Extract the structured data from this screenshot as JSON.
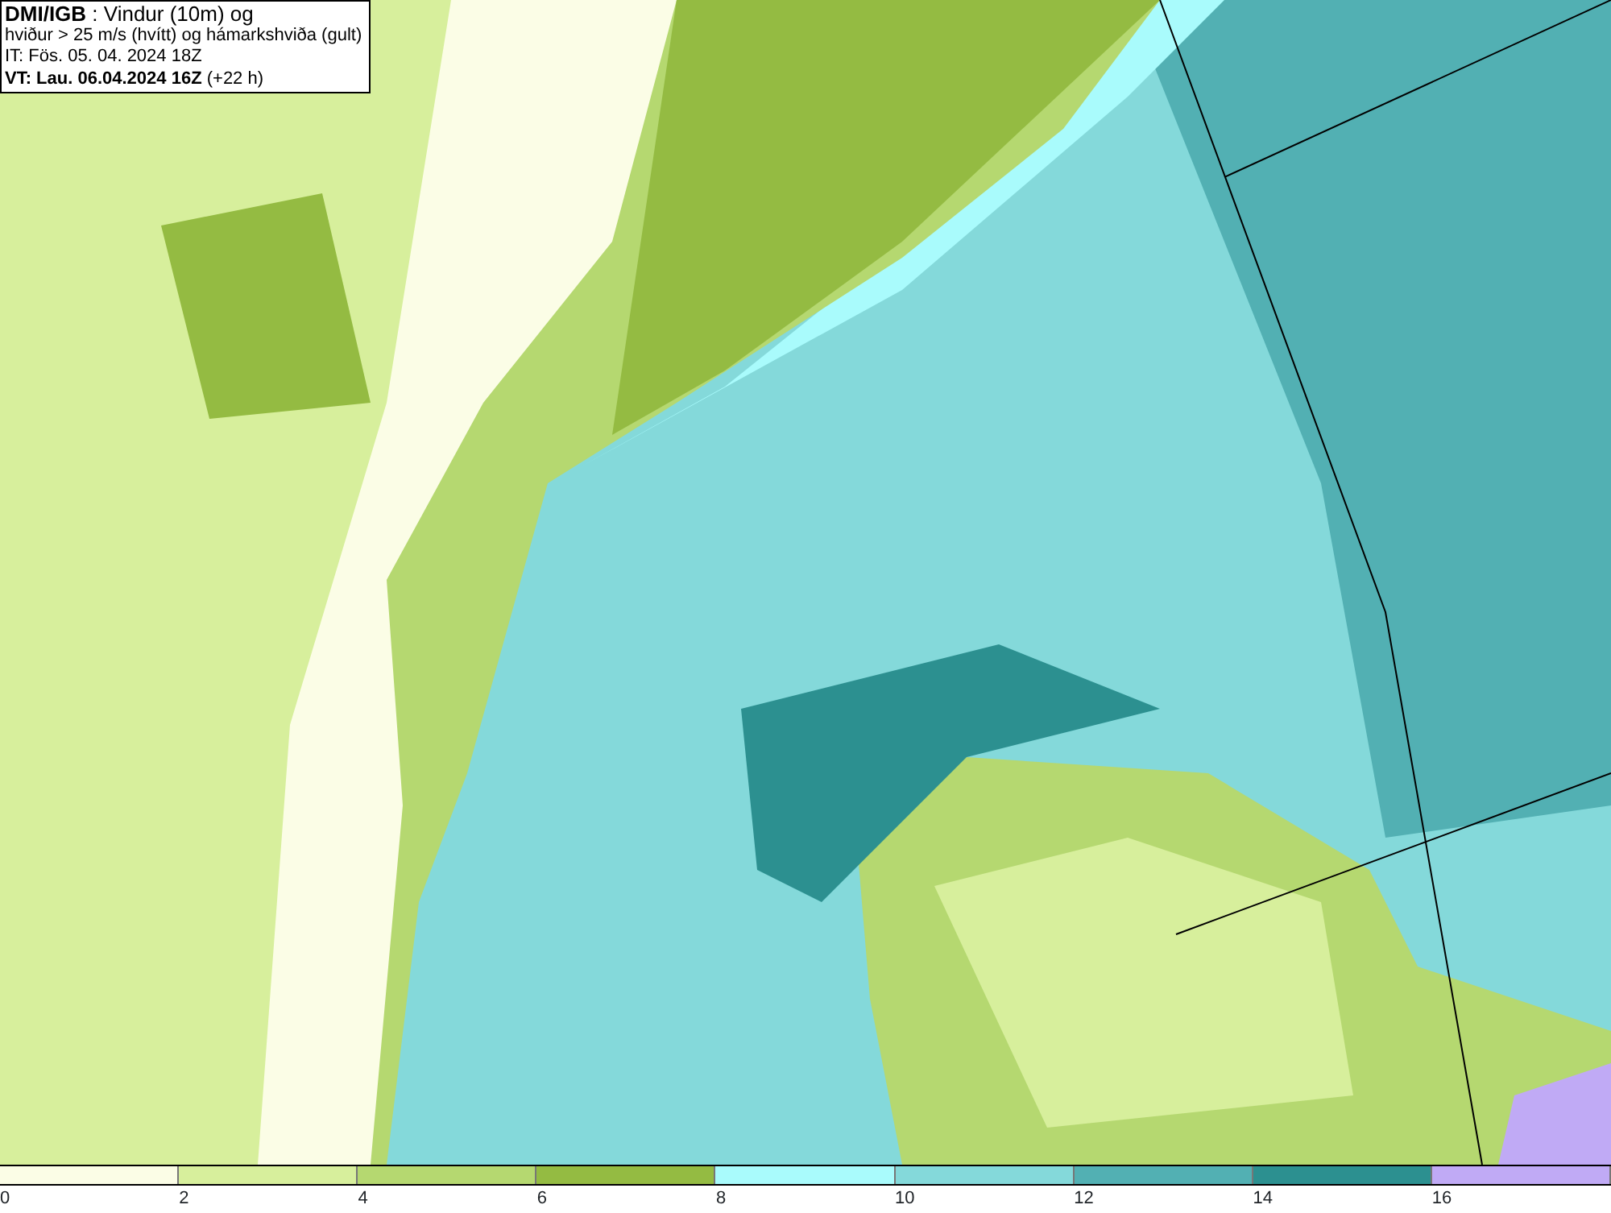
{
  "header": {
    "lines": [
      "**DMI/IGB** : Vindur (10m) og",
      "hviður > 25 m/s (hvítt) og hámarkshviða (gult)",
      "IT: Fös. 05. 04. 2024 18Z",
      "**VT: Lau. 06.04.2024 16Z** (+22 h)"
    ]
  },
  "legend": [
    {
      "label": "0",
      "color": "#fbfde6"
    },
    {
      "label": "2",
      "color": "#d7ef9c"
    },
    {
      "label": "4",
      "color": "#b5d870"
    },
    {
      "label": "6",
      "color": "#94bb42"
    },
    {
      "label": "8",
      "color": "#a9fbfc"
    },
    {
      "label": "10",
      "color": "#84d9da"
    },
    {
      "label": "12",
      "color": "#52b0b3"
    },
    {
      "label": "14",
      "color": "#2c9090"
    },
    {
      "label": "16",
      "color": "#c0aaf5"
    }
  ]
}
